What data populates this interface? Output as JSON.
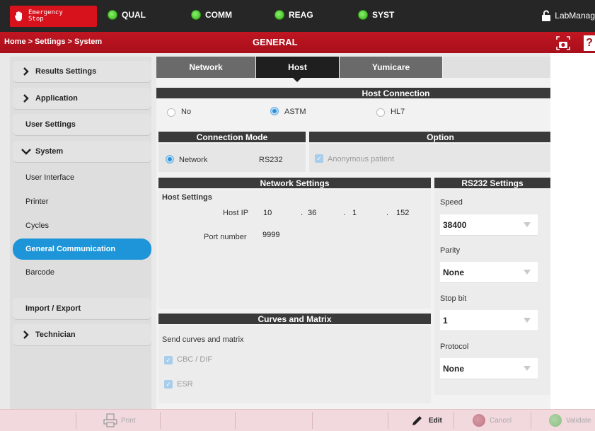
{
  "topbar": {
    "emergency_line1": "Emergency",
    "emergency_line2": "Stop",
    "status": [
      {
        "label": "QUAL",
        "color": "#3cc21f"
      },
      {
        "label": "COMM",
        "color": "#3cc21f"
      },
      {
        "label": "REAG",
        "color": "#3cc21f"
      },
      {
        "label": "SYST",
        "color": "#3cc21f"
      }
    ],
    "user": "LabManag"
  },
  "header": {
    "breadcrumb": "Home > Settings > System",
    "title": "GENERAL"
  },
  "sidebar": {
    "items": [
      {
        "label": "Results Settings",
        "icon": "chevron-right-icon"
      },
      {
        "label": "Application",
        "icon": "chevron-right-icon"
      },
      {
        "label": "User Settings"
      },
      {
        "label": "System",
        "icon": "chevron-down-icon"
      },
      {
        "label": "User Interface"
      },
      {
        "label": "Printer"
      },
      {
        "label": "Cycles"
      },
      {
        "label": "General Communication",
        "active": true
      },
      {
        "label": "Barcode"
      },
      {
        "label": "Import / Export"
      },
      {
        "label": "Technician",
        "icon": "chevron-right-icon"
      }
    ]
  },
  "tabs": [
    {
      "label": "Network"
    },
    {
      "label": "Host",
      "active": true
    },
    {
      "label": "Yumicare"
    }
  ],
  "host_connection": {
    "title": "Host Connection",
    "options": [
      "No",
      "ASTM",
      "HL7"
    ],
    "selected": "ASTM"
  },
  "connection_mode": {
    "title": "Connection Mode",
    "options": [
      "Network",
      "RS232"
    ],
    "selected": "Network"
  },
  "option": {
    "title": "Option",
    "anonymous_label": "Anonymous patient",
    "anonymous_checked": true
  },
  "network_settings": {
    "title": "Network Settings",
    "host_settings_label": "Host Settings",
    "host_ip_label": "Host IP",
    "ip": [
      "10",
      "36",
      "1",
      "152"
    ],
    "port_label": "Port number",
    "port": "9999"
  },
  "rs232": {
    "title": "RS232 Settings",
    "speed_label": "Speed",
    "speed": "38400",
    "parity_label": "Parity",
    "parity": "None",
    "stopbit_label": "Stop bit",
    "stopbit": "1",
    "protocol_label": "Protocol",
    "protocol": "None"
  },
  "curves": {
    "title": "Curves and Matrix",
    "send_label": "Send curves and matrix",
    "cbc_label": "CBC / DIF",
    "esr_label": "ESR"
  },
  "bottombar": {
    "print": "Print",
    "edit": "Edit",
    "cancel": "Cancel",
    "validate": "Validate"
  }
}
